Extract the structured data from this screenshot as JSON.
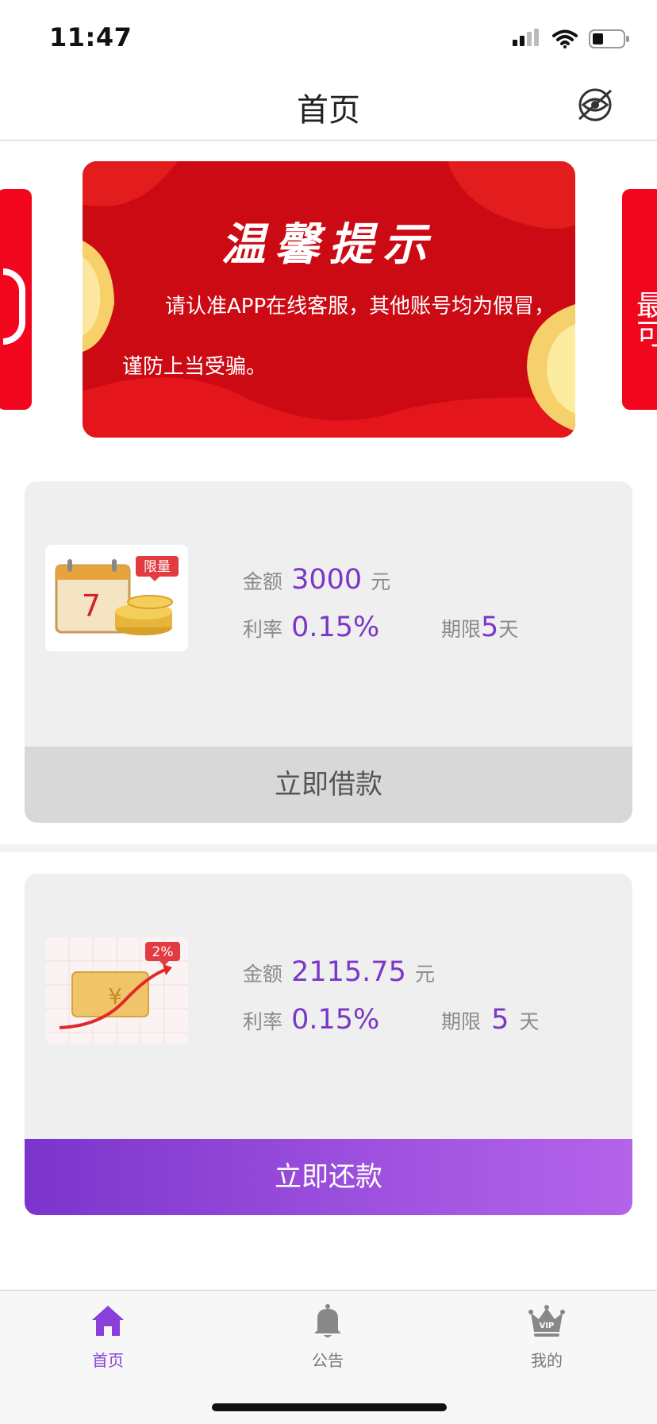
{
  "status_bar": {
    "time": "11:47"
  },
  "nav": {
    "title": "首页",
    "action_icon": "no-eye-icon"
  },
  "banner": {
    "title": "温馨提示",
    "line1": "请认准APP在线客服，其他账号均为假冒，",
    "line2": "谨防上当受骗。"
  },
  "side_peek": {
    "right_text": "最可"
  },
  "cards": [
    {
      "amount_label": "金额",
      "amount": "3000",
      "amount_unit": "元",
      "rate_label": "利率",
      "rate": "0.15%",
      "term_label": "期限",
      "term": "5",
      "term_unit": "天",
      "image_badge": "限量",
      "image_day": "7",
      "button": "立即借款"
    },
    {
      "amount_label": "金额",
      "amount": "2115.75",
      "amount_unit": "元",
      "rate_label": "利率",
      "rate": "0.15%",
      "term_label": "期限",
      "term": "5",
      "term_unit": "天",
      "image_badge": "2%",
      "image_symbol": "¥",
      "button": "立即还款"
    }
  ],
  "tabs": [
    {
      "label": "首页",
      "icon": "home-icon",
      "active": true
    },
    {
      "label": "公告",
      "icon": "bell-icon",
      "active": false
    },
    {
      "label": "我的",
      "icon": "vip-crown-icon",
      "active": false
    }
  ],
  "colors": {
    "accent": "#7a37c8",
    "banner_red": "#cc0a14",
    "side_red": "#f2061e"
  }
}
